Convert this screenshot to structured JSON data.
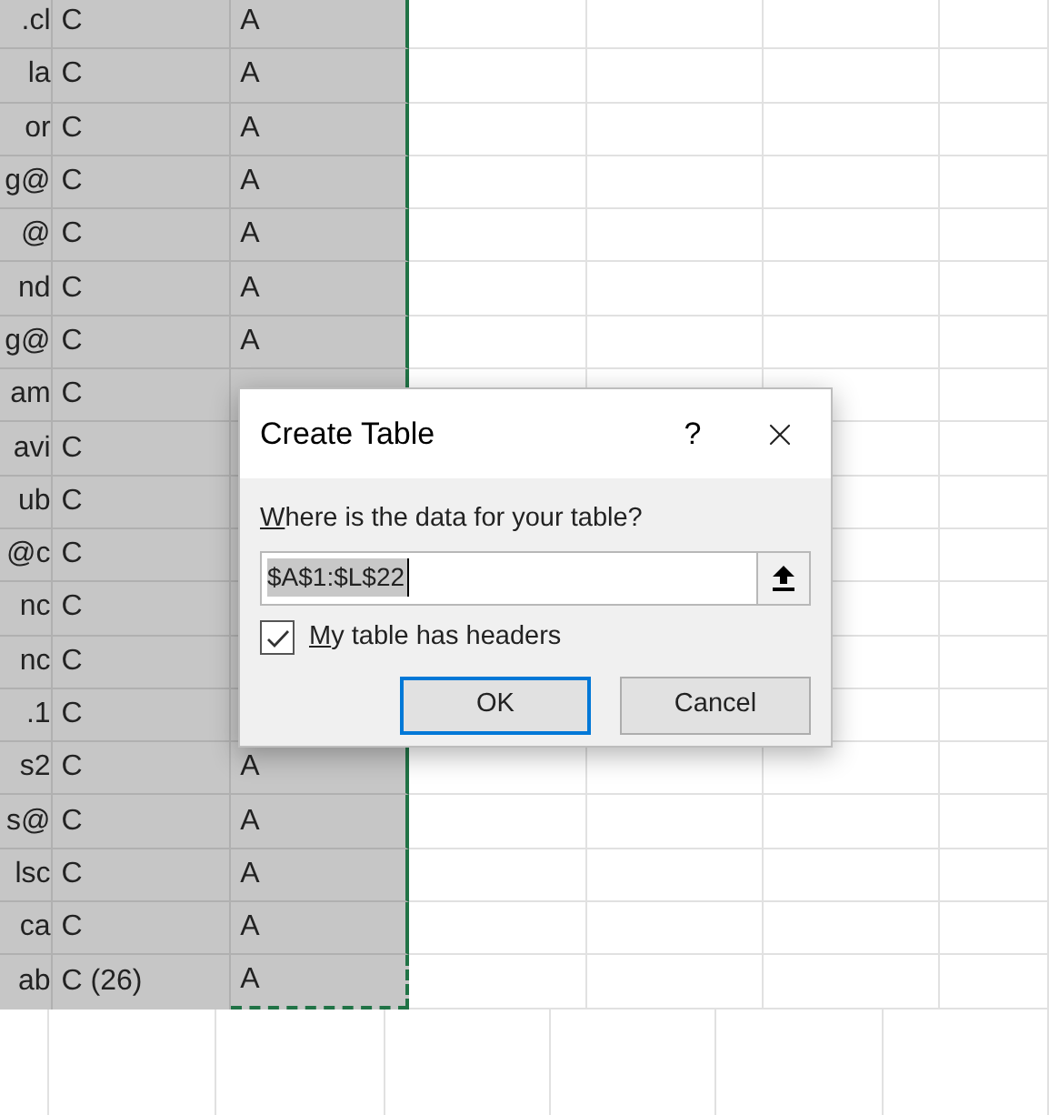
{
  "sheet": {
    "rows": [
      {
        "column_1": ".cl",
        "column_2": "C",
        "column_3": "A"
      },
      {
        "column_1": "la",
        "column_2": "C",
        "column_3": "A"
      },
      {
        "column_1": "or",
        "column_2": "C",
        "column_3": "A"
      },
      {
        "column_1": "g@",
        "column_2": "C",
        "column_3": "A"
      },
      {
        "column_1": "@",
        "column_2": "C",
        "column_3": "A"
      },
      {
        "column_1": "nd",
        "column_2": "C",
        "column_3": "A"
      },
      {
        "column_1": "g@",
        "column_2": "C",
        "column_3": "A"
      },
      {
        "column_1": "am",
        "column_2": "C"
      },
      {
        "column_1": "avi",
        "column_2": "C"
      },
      {
        "column_1": "ub",
        "column_2": "C"
      },
      {
        "column_1": "@c",
        "column_2": "C"
      },
      {
        "column_1": "nc",
        "column_2": "C"
      },
      {
        "column_1": "nc",
        "column_2": "C"
      },
      {
        "column_1": ".1",
        "column_2": "C"
      },
      {
        "column_1": "s2",
        "column_2": "C",
        "column_3": "A"
      },
      {
        "column_1": "s@",
        "column_2": "C",
        "column_3": "A"
      },
      {
        "column_1": "lsc",
        "column_2": "C",
        "column_3": "A"
      },
      {
        "column_1": "ca",
        "column_2": "C",
        "column_3": "A"
      },
      {
        "column_1": "ab",
        "column_2": "C (26)",
        "column_3": "A"
      }
    ]
  },
  "dialog": {
    "title": "Create Table",
    "help": "?",
    "range_label": {
      "text": "Where is the data for your table?"
    },
    "range_field": {
      "value": "$A$1:$L$22",
      "selected": true
    },
    "headers_checkbox": {
      "label": "My table has headers",
      "checked": true
    },
    "buttons": [
      {
        "label": "OK",
        "default": true
      },
      {
        "label": "Cancel",
        "default": false
      }
    ]
  }
}
